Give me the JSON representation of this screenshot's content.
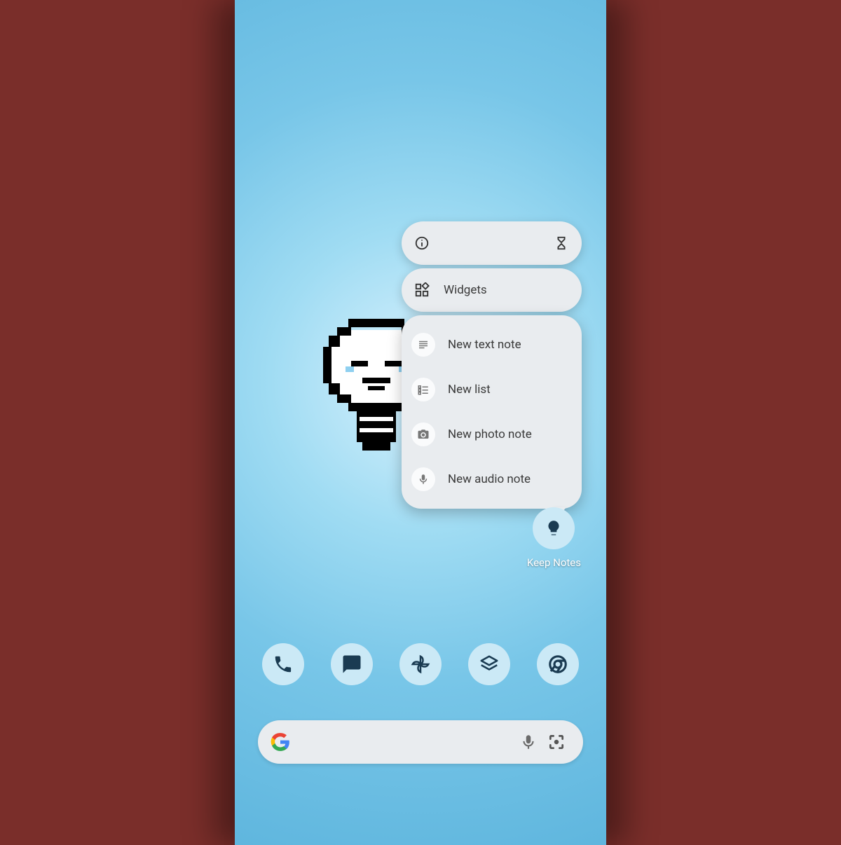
{
  "popup": {
    "widgets_label": "Widgets",
    "actions": [
      {
        "label": "New text note"
      },
      {
        "label": "New list"
      },
      {
        "label": "New photo note"
      },
      {
        "label": "New audio note"
      }
    ]
  },
  "keep_app": {
    "label": "Keep Notes"
  },
  "dock": {
    "apps": [
      "phone",
      "messages",
      "photos",
      "maps-layers",
      "chrome"
    ]
  },
  "search": {
    "placeholder": ""
  }
}
